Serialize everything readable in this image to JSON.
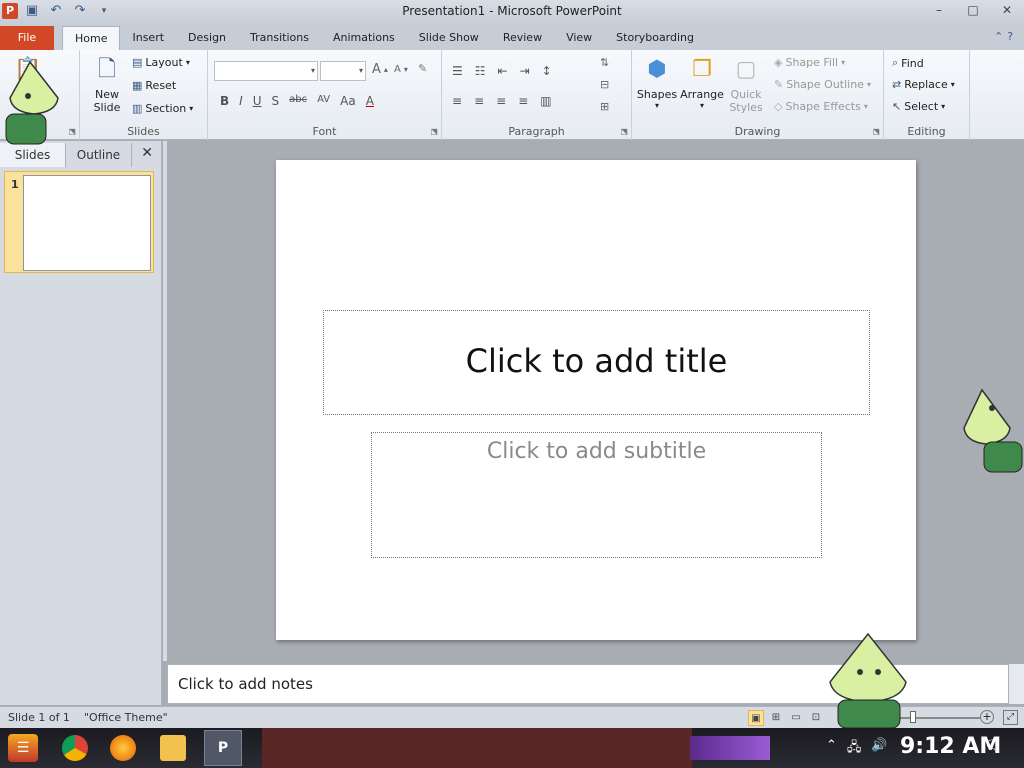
{
  "window": {
    "title": "Presentation1 - Microsoft PowerPoint",
    "app_icon": "P",
    "controls": [
      "–",
      "□",
      "✕"
    ]
  },
  "ribbon_tabs": {
    "file": "File",
    "items": [
      "Home",
      "Insert",
      "Design",
      "Transitions",
      "Animations",
      "Slide Show",
      "Review",
      "View",
      "Storyboarding"
    ],
    "active": "Home"
  },
  "ribbon": {
    "clipboard": {
      "label": "ard"
    },
    "slides": {
      "label": "Slides",
      "new_slide_line1": "New",
      "new_slide_line2": "Slide",
      "layout": "Layout",
      "reset": "Reset",
      "section": "Section"
    },
    "font": {
      "label": "Font",
      "bold": "B",
      "italic": "I",
      "underline": "U",
      "shadow": "S",
      "strike": "abc",
      "spacing": "AV",
      "case": "Aa",
      "color": "A",
      "grow": "A",
      "shrink": "A"
    },
    "paragraph": {
      "label": "Paragraph"
    },
    "drawing": {
      "label": "Drawing",
      "shapes": "Shapes",
      "arrange": "Arrange",
      "quick_line1": "Quick",
      "quick_line2": "Styles",
      "shape_fill": "Shape Fill",
      "shape_outline": "Shape Outline",
      "shape_effects": "Shape Effects"
    },
    "editing": {
      "label": "Editing",
      "find": "Find",
      "replace": "Replace",
      "select": "Select"
    }
  },
  "slides_pane": {
    "tab_slides": "Slides",
    "tab_outline": "Outline",
    "close": "✕",
    "thumb_number": "1"
  },
  "slide": {
    "title_placeholder": "Click to add title",
    "subtitle_placeholder": "Click to add subtitle"
  },
  "notes": {
    "placeholder": "Click to add notes"
  },
  "status": {
    "slide_count": "Slide 1 of 1",
    "theme": "\"Office Theme\""
  },
  "taskbar": {
    "clock": "9:12 AM"
  },
  "colors": {
    "file_tab": "#d24726",
    "ribbon_bg": "#f4f6f9",
    "slide_bg": "#ffffff",
    "workspace": "#a8acb3",
    "selection": "#fbe29c"
  }
}
